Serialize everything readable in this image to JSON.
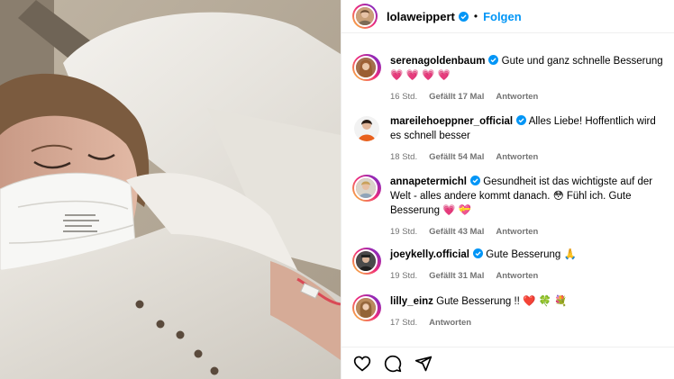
{
  "post": {
    "author": "lolaweippert",
    "separator": "•",
    "follow_label": "Folgen"
  },
  "comments": [
    {
      "username": "serenagoldenbaum",
      "text": "Gute und ganz schnelle Besserung",
      "emoji": "💗 💗 💗 💗",
      "time": "16 Std.",
      "likes": "Gefällt 17 Mal",
      "reply": "Antworten",
      "verified": true
    },
    {
      "username": "mareilehoeppner_official",
      "text": "Alles Liebe! Hoffentlich wird es schnell besser",
      "emoji": "",
      "time": "18 Std.",
      "likes": "Gefällt 54 Mal",
      "reply": "Antworten",
      "verified": true
    },
    {
      "username": "annapetermichl",
      "text": "Gesundheit ist das wichtigste auf der Welt - alles andere kommt danach.",
      "emoji": "😳 Fühl ich. Gute Besserung 💗 💝",
      "time": "19 Std.",
      "likes": "Gefällt 43 Mal",
      "reply": "Antworten",
      "verified": true
    },
    {
      "username": "joeykelly.official",
      "text": "Gute Besserung",
      "emoji": "🙏",
      "time": "19 Std.",
      "likes": "Gefällt 31 Mal",
      "reply": "Antworten",
      "verified": true
    },
    {
      "username": "lilly_einz",
      "text": "Gute Besserung !!",
      "emoji": "❤️ 🍀 💐",
      "time": "17 Std.",
      "likes": "",
      "reply": "Antworten",
      "verified": false
    }
  ],
  "actions": {
    "like_icon": "heart-icon",
    "comment_icon": "comment-icon",
    "share_icon": "share-icon"
  },
  "colors": {
    "accent": "#0095f6",
    "meta_text": "#737373",
    "verified": "#0095f6",
    "heart": "#ed1f4f"
  }
}
